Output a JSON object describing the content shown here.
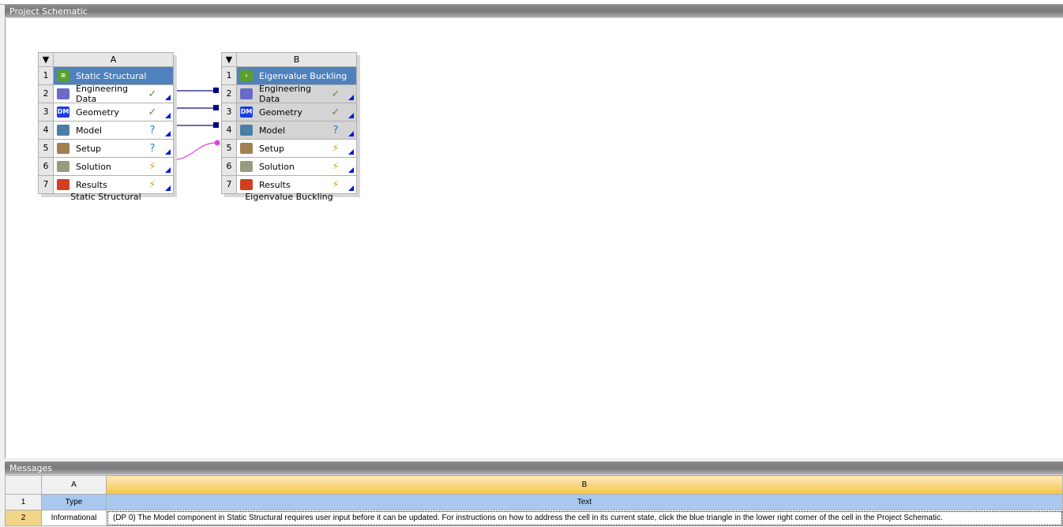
{
  "schematic": {
    "title": "Project Schematic",
    "systems": [
      {
        "col": "A",
        "title": "Static Structural",
        "label": "Static Structural",
        "title_icon": "static-structural-icon",
        "title_color": "#5aa02c",
        "rows": [
          {
            "n": "2",
            "label": "Engineering Data",
            "icon": "engineering-data-icon",
            "status": "check"
          },
          {
            "n": "3",
            "label": "Geometry",
            "icon": "geometry-dm-icon",
            "status": "check"
          },
          {
            "n": "4",
            "label": "Model",
            "icon": "model-icon",
            "status": "question"
          },
          {
            "n": "5",
            "label": "Setup",
            "icon": "setup-icon",
            "status": "question"
          },
          {
            "n": "6",
            "label": "Solution",
            "icon": "solution-icon",
            "status": "lightning"
          },
          {
            "n": "7",
            "label": "Results",
            "icon": "results-icon",
            "status": "lightning"
          }
        ]
      },
      {
        "col": "B",
        "title": "Eigenvalue Buckling",
        "label": "Eigenvalue Buckling",
        "title_icon": "eigenvalue-buckling-icon",
        "title_color": "#5aa02c",
        "rows": [
          {
            "n": "2",
            "label": "Engineering Data",
            "icon": "engineering-data-icon",
            "status": "check",
            "shared": true
          },
          {
            "n": "3",
            "label": "Geometry",
            "icon": "geometry-dm-icon",
            "status": "check",
            "shared": true
          },
          {
            "n": "4",
            "label": "Model",
            "icon": "model-icon",
            "status": "question",
            "shared": true
          },
          {
            "n": "5",
            "label": "Setup",
            "icon": "setup-icon",
            "status": "lightning"
          },
          {
            "n": "6",
            "label": "Solution",
            "icon": "solution-icon",
            "status": "lightning"
          },
          {
            "n": "7",
            "label": "Results",
            "icon": "results-icon",
            "status": "lightning"
          }
        ]
      }
    ],
    "dm_text": "DM"
  },
  "messages": {
    "title": "Messages",
    "col_a": "A",
    "col_b": "B",
    "row1_num": "1",
    "row1_a": "Type",
    "row1_b": "Text",
    "row2_num": "2",
    "row2_a": "Informational",
    "row2_b": "(DP 0) The Model component in Static Structural requires user input before it can be updated. For instructions on how to address the cell in its current state, click the blue triangle in the lower right corner of the cell in the Project Schematic."
  }
}
